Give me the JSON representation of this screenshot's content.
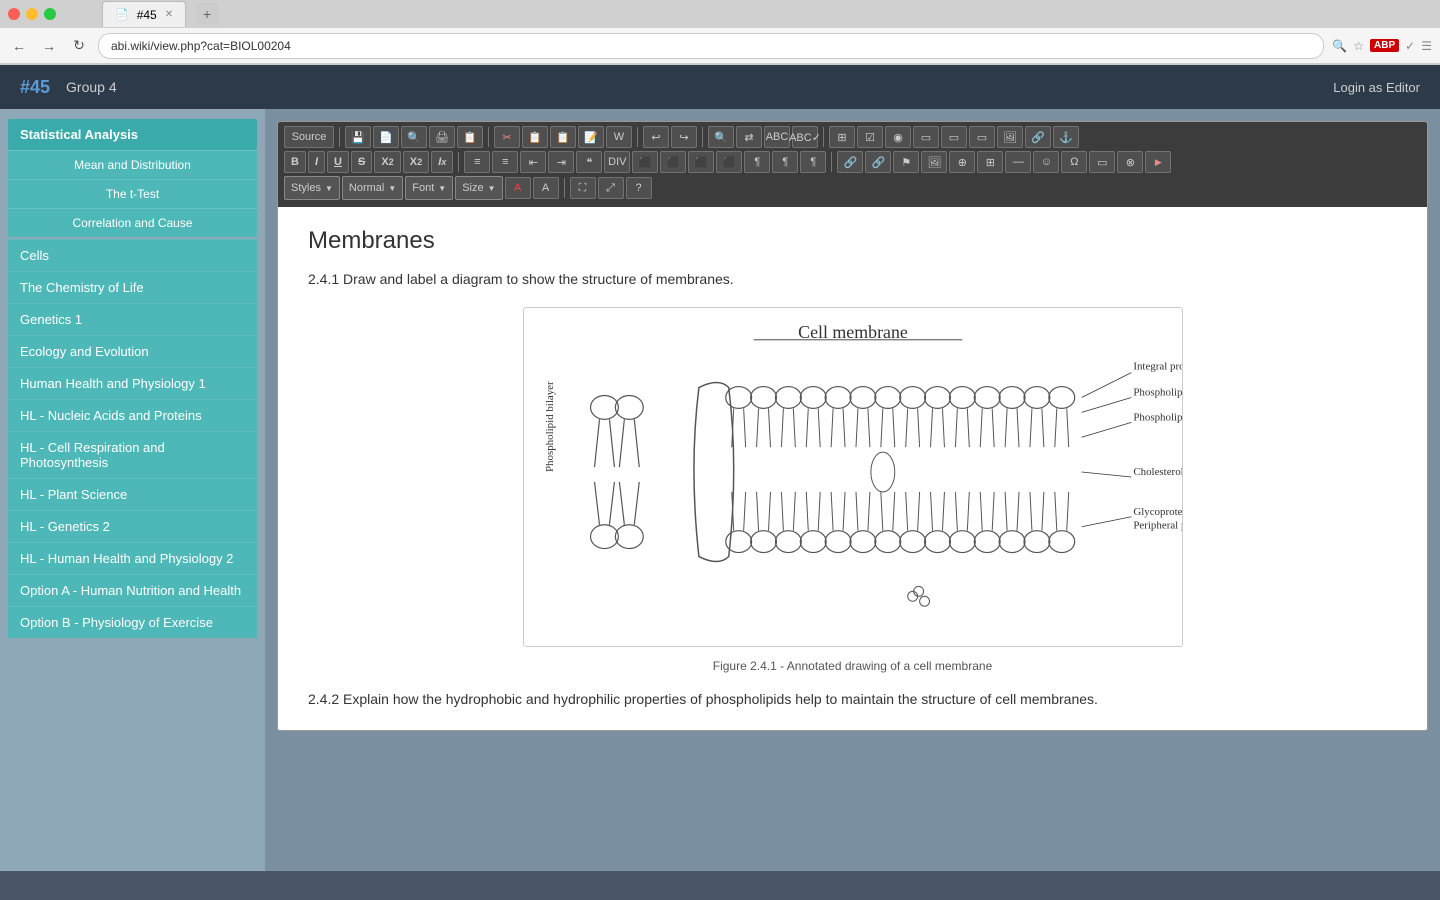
{
  "browser": {
    "tab_title": "#45",
    "url": "abi.wiki/view.php?cat=BIOL00204"
  },
  "header": {
    "number": "#45",
    "group": "Group 4",
    "login": "Login as Editor"
  },
  "sidebar": {
    "header": "Statistical Analysis",
    "sub_items": [
      "Mean and Distribution",
      "The t-Test",
      "Correlation and Cause"
    ],
    "links": [
      "Cells",
      "The Chemistry of Life",
      "Genetics 1",
      "Ecology and Evolution",
      "Human Health and Physiology 1",
      "HL - Nucleic Acids and Proteins",
      "HL - Cell Respiration and Photosynthesis",
      "HL - Plant Science",
      "HL - Genetics 2",
      "HL - Human Health and Physiology 2",
      "Option A - Human Nutrition and Health",
      "Option B - Physiology of Exercise"
    ]
  },
  "toolbar": {
    "styles_label": "Styles",
    "normal_label": "Normal",
    "font_label": "Font",
    "size_label": "Size"
  },
  "content": {
    "page_title": "Membranes",
    "section_label": "2.4.1 Draw and label a diagram to show the structure of membranes.",
    "figure_caption": "Figure 2.4.1 - Annotated drawing of a cell membrane",
    "section2_label": "2.4.2 Explain how the hydrophobic and hydrophilic properties of phospholipids help to maintain the structure of cell membranes."
  }
}
